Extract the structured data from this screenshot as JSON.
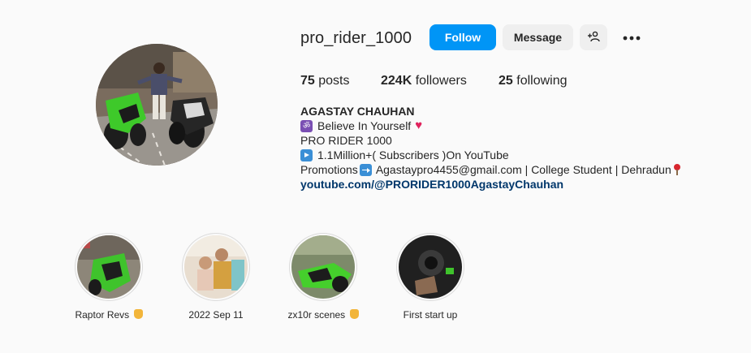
{
  "profile": {
    "username": "pro_rider_1000",
    "follow_label": "Follow",
    "message_label": "Message",
    "add_user_icon": "add-user-icon",
    "more_icon": "more-options-icon"
  },
  "stats": {
    "posts_count": "75",
    "posts_label": "posts",
    "followers_count": "224K",
    "followers_label": "followers",
    "following_count": "25",
    "following_label": "following"
  },
  "bio": {
    "full_name": "AGASTAY CHAUHAN",
    "line1": "Believe In Yourself",
    "line2": "PRO RIDER 1000",
    "line3": "1.1Million+( Subscribers )On YouTube",
    "line4_prefix": "Promotions",
    "line4_text": "Agastaypro4455@gmail.com | College Student | Dehradun",
    "link": "youtube.com/@PRORIDER1000AgastayChauhan"
  },
  "highlights": [
    {
      "label": "Raptor Revs"
    },
    {
      "label": "2022 Sep 11"
    },
    {
      "label": "zx10r scenes"
    },
    {
      "label": "First start up"
    }
  ],
  "colors": {
    "accent": "#0095f6",
    "link": "#00376b",
    "background": "#fafafa",
    "secondary_button": "#efefef"
  }
}
